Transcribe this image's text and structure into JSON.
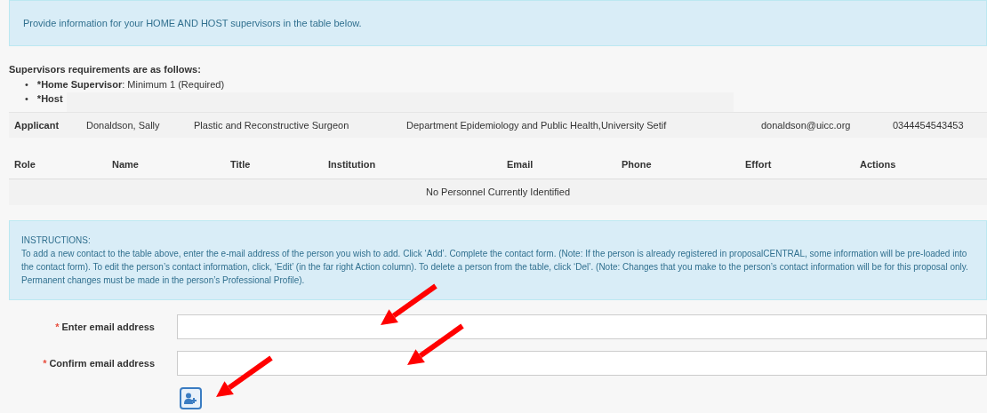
{
  "notice": "Provide information for your HOME AND HOST supervisors in the table below.",
  "requirements": {
    "heading": "Supervisors requirements are as follows:",
    "items": [
      {
        "bullet": "•",
        "label": "*Home Supervisor",
        "text": ": Minimum 1 (Required)"
      },
      {
        "bullet": "•",
        "label": "*Host"
      }
    ]
  },
  "applicant": {
    "label": "Applicant",
    "cells": [
      "Donaldson, Sally",
      "Plastic and Reconstructive Surgeon",
      "Department Epidemiology and Public Health,University Setif",
      "donaldson@uicc.org",
      "0344454543453"
    ]
  },
  "personnel_table": {
    "columns": [
      "Role",
      "Name",
      "Title",
      "Institution",
      "Email",
      "Phone",
      "Effort",
      "Actions"
    ],
    "empty_message": "No Personnel Currently Identified"
  },
  "instructions": {
    "title": "INSTRUCTIONS:",
    "body": "To add a new contact to the table above, enter the e-mail address of the person you wish to add. Click ‘Add’. Complete the contact form. (Note: If the person is already registered in proposalCENTRAL, some information will be pre-loaded into the contact form). To edit the person’s contact information, click, ‘Edit’ (in the far right Action column). To delete a person from the table, click ‘Del’. (Note: Changes that you make to the person’s contact information will be for this proposal only. Permanent changes must be made in the person’s Professional Profile)."
  },
  "form": {
    "fields": [
      {
        "marker": "*",
        "label": "Enter email address"
      },
      {
        "marker": "*",
        "label": "Confirm email address"
      }
    ]
  }
}
